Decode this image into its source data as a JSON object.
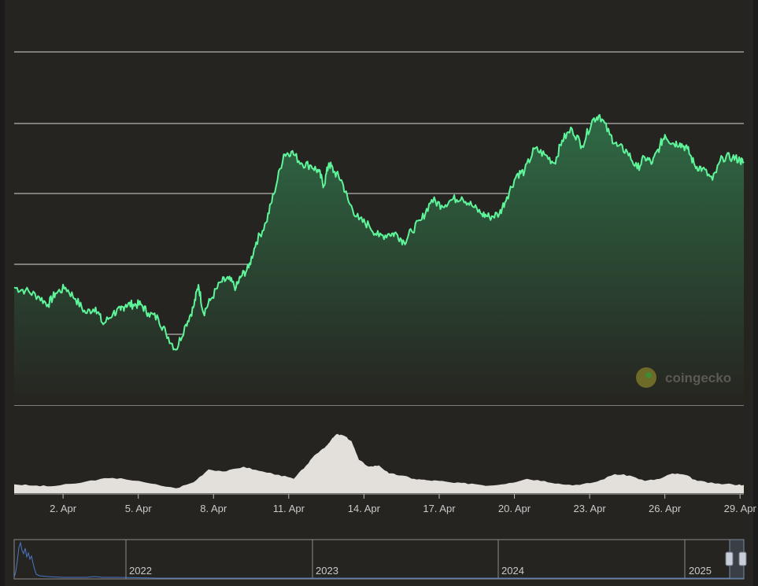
{
  "colors": {
    "background": "#262420",
    "outer_background": "#1b1b1b",
    "price_line": "#5ef59a",
    "area_top": "#2f6a45",
    "area_bottom": "#262420",
    "gridline": "#d9d9d9",
    "volume_fill": "#e3e0db",
    "navigator_line": "#4a78c7",
    "navigator_handle": "#c8ced8"
  },
  "brand": {
    "name": "coingecko",
    "icon": "gecko-logo-icon"
  },
  "navigator": {
    "labels": [
      "2022",
      "2023",
      "2024",
      "2025"
    ]
  },
  "chart_data": [
    {
      "type": "line",
      "title": "",
      "xlabel": "",
      "ylabel": "",
      "grid": true,
      "x_ticks": [
        "2. Apr",
        "5. Apr",
        "8. Apr",
        "11. Apr",
        "14. Apr",
        "17. Apr",
        "20. Apr",
        "23. Apr",
        "26. Apr",
        "29. Apr"
      ],
      "x_tick_days": [
        2,
        5,
        8,
        11,
        14,
        17,
        20,
        23,
        26,
        29
      ],
      "xlim_days": [
        0.05,
        29.15
      ],
      "ylim": [
        0,
        100
      ],
      "series": [
        {
          "x_days": [
            0.05,
            0.5,
            1.0,
            1.4,
            1.7,
            2.1,
            2.5,
            2.9,
            3.3,
            3.6,
            4.0,
            4.3,
            4.5,
            4.8,
            5.1,
            5.4,
            5.8,
            6.1,
            6.5,
            6.9,
            7.2,
            7.4,
            7.6,
            7.9,
            8.3,
            8.6,
            8.9,
            9.1,
            9.4,
            9.7,
            10.1,
            10.4,
            10.8,
            11.1,
            11.5,
            11.9,
            12.2,
            12.4,
            12.6,
            12.8,
            13.1,
            13.4,
            13.8,
            14.2,
            14.6,
            15.0,
            15.3,
            15.6,
            15.9,
            16.3,
            16.7,
            17.1,
            17.5,
            17.9,
            18.3,
            18.7,
            19.0,
            19.4,
            19.7,
            20.1,
            20.4,
            20.8,
            21.2,
            21.6,
            21.9,
            22.3,
            22.7,
            23.1,
            23.4,
            23.8,
            24.1,
            24.5,
            24.9,
            25.2,
            25.5,
            25.8,
            26.0,
            26.3,
            26.6,
            26.9,
            27.2,
            27.5,
            27.9,
            28.3,
            28.7,
            29.0,
            29.15
          ],
          "values": [
            29,
            28,
            26,
            23,
            27,
            29,
            25,
            20,
            22,
            16,
            20,
            21,
            23,
            23,
            23,
            20,
            18,
            13,
            7,
            16,
            22,
            30,
            20,
            25,
            31,
            32,
            29,
            33,
            36,
            45,
            52,
            62,
            76,
            77,
            73,
            72,
            70,
            65,
            73,
            70,
            67,
            59,
            53,
            51,
            47,
            48,
            48,
            45,
            49,
            53,
            60,
            58,
            60,
            61,
            58,
            55,
            54,
            55,
            61,
            69,
            70,
            78,
            76,
            73,
            81,
            85,
            79,
            88,
            90,
            83,
            79,
            77,
            71,
            75,
            73,
            79,
            83,
            80,
            80,
            78,
            72,
            71,
            67,
            75,
            75,
            74,
            73
          ]
        }
      ]
    },
    {
      "type": "area",
      "title": "",
      "xlabel": "",
      "ylabel": "",
      "grid": false,
      "xlim_days": [
        0.05,
        29.15
      ],
      "ylim": [
        0,
        100
      ],
      "series": [
        {
          "x_days": [
            0.05,
            0.8,
            1.5,
            2.5,
            3.5,
            4.3,
            5.5,
            6.5,
            7.2,
            7.8,
            8.5,
            9.2,
            9.8,
            10.6,
            11.2,
            11.7,
            12.1,
            12.5,
            12.7,
            12.9,
            13.2,
            13.5,
            13.8,
            14.2,
            14.6,
            15.0,
            15.5,
            16.0,
            16.5,
            17.0,
            17.6,
            18.3,
            19.0,
            19.8,
            20.5,
            21.2,
            21.9,
            22.6,
            23.3,
            24.0,
            24.6,
            25.2,
            25.8,
            26.3,
            26.8,
            27.3,
            28.0,
            28.7,
            29.15
          ],
          "values": [
            12,
            10,
            9,
            13,
            20,
            21,
            13,
            6,
            15,
            34,
            31,
            38,
            32,
            26,
            20,
            40,
            57,
            69,
            78,
            86,
            84,
            76,
            48,
            38,
            40,
            28,
            25,
            20,
            18,
            17,
            14,
            13,
            10,
            14,
            20,
            17,
            12,
            11,
            16,
            27,
            25,
            17,
            20,
            28,
            26,
            17,
            13,
            12,
            11
          ]
        }
      ]
    }
  ]
}
